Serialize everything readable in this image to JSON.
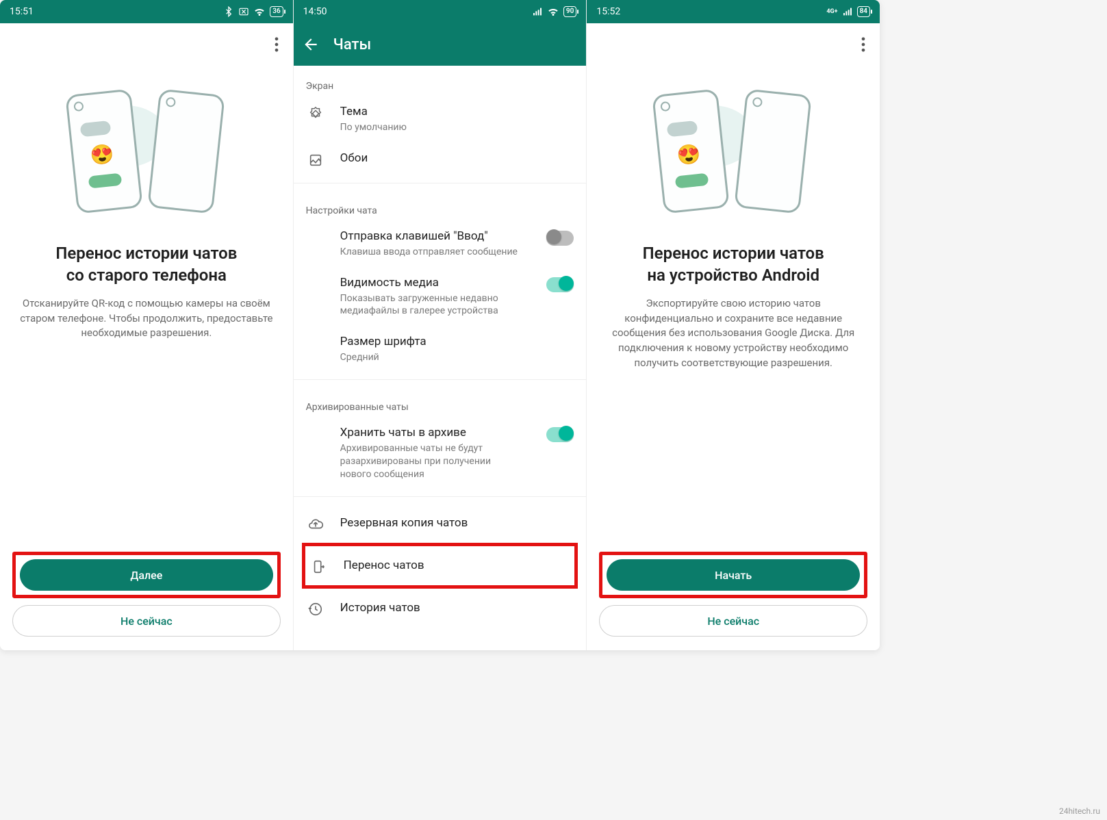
{
  "watermark": "24hitech.ru",
  "screen1": {
    "status_time": "15:51",
    "status_battery": "36",
    "title_line1": "Перенос истории чатов",
    "title_line2": "со старого телефона",
    "desc": "Отсканируйте QR-код с помощью камеры на своём старом телефоне. Чтобы продолжить, предоставьте необходимые разрешения.",
    "primary_btn": "Далее",
    "secondary_btn": "Не сейчас"
  },
  "screen2": {
    "status_time": "14:50",
    "status_battery": "90",
    "appbar_title": "Чаты",
    "section_display": "Экран",
    "theme_title": "Тема",
    "theme_sub": "По умолчанию",
    "wallpaper_title": "Обои",
    "section_chat": "Настройки чата",
    "enter_title": "Отправка клавишей \"Ввод\"",
    "enter_sub": "Клавиша ввода отправляет сообщение",
    "media_title": "Видимость медиа",
    "media_sub": "Показывать загруженные недавно медиафайлы в галерее устройства",
    "font_title": "Размер шрифта",
    "font_sub": "Средний",
    "section_arch": "Архивированные чаты",
    "arch_title": "Хранить чаты в архиве",
    "arch_sub": "Архивированные чаты не будут разархивированы при получении нового сообщения",
    "backup_title": "Резервная копия чатов",
    "transfer_title": "Перенос чатов",
    "history_title": "История чатов"
  },
  "screen3": {
    "status_time": "15:52",
    "status_battery": "84",
    "status_net": "4G+",
    "title_line1": "Перенос истории чатов",
    "title_line2": "на устройство Android",
    "desc": "Экспортируйте свою историю чатов конфиденциально и сохраните все недавние сообщения без использования Google Диска. Для подключения к новому устройству необходимо получить соответствующие разрешения.",
    "primary_btn": "Начать",
    "secondary_btn": "Не сейчас"
  }
}
